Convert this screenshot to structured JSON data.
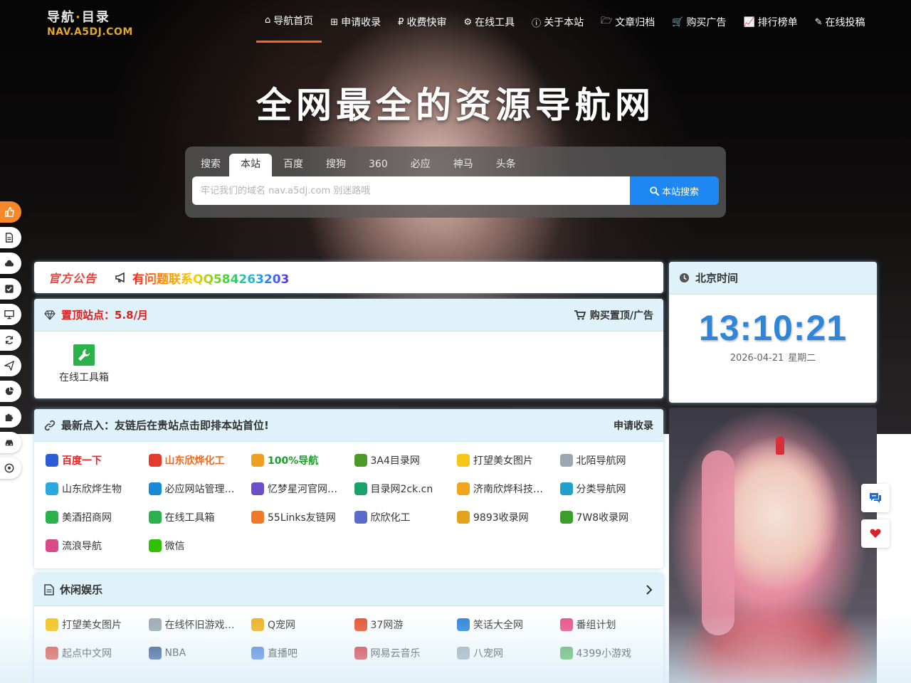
{
  "logo": {
    "line1_a": "导航",
    "line1_sep": "·",
    "line1_b": "目录",
    "line2": "NAV.A5DJ.COM"
  },
  "nav": [
    {
      "label": "导航首页",
      "icon": "home-icon"
    },
    {
      "label": "申请收录",
      "icon": "plus-square-icon"
    },
    {
      "label": "收费快审",
      "icon": "ruble-icon"
    },
    {
      "label": "在线工具",
      "icon": "gears-icon"
    },
    {
      "label": "关于本站",
      "icon": "info-icon"
    },
    {
      "label": "文章归档",
      "icon": "folder-open-icon"
    },
    {
      "label": "购买广告",
      "icon": "cart-icon"
    },
    {
      "label": "排行榜单",
      "icon": "line-chart-icon"
    },
    {
      "label": "在线投稿",
      "icon": "edit-icon"
    }
  ],
  "hero": {
    "title": "全网最全的资源导航网"
  },
  "search": {
    "lead": "搜索",
    "tabs": [
      "本站",
      "百度",
      "搜狗",
      "360",
      "必应",
      "神马",
      "头条"
    ],
    "active_tab": "本站",
    "placeholder": "牢记我们的域名 nav.a5dj.com 别迷路哦",
    "value": "",
    "button_label": "本站搜索"
  },
  "left_tools": [
    {
      "icon": "thumbs-up-icon"
    },
    {
      "icon": "file-icon"
    },
    {
      "icon": "cloud-icon"
    },
    {
      "icon": "check-square-icon"
    },
    {
      "icon": "desktop-icon"
    },
    {
      "icon": "refresh-icon"
    },
    {
      "icon": "paper-plane-icon"
    },
    {
      "icon": "pie-chart-icon"
    },
    {
      "icon": "puzzle-icon"
    },
    {
      "icon": "car-icon"
    },
    {
      "icon": "soccer-ball-icon"
    }
  ],
  "notice": {
    "label": "官方公告",
    "text": "有问题联系QQ584263203"
  },
  "clock": {
    "title": "北京时间",
    "time": "13:10:21",
    "date": "2026-04-21",
    "weekday": "星期二"
  },
  "pinned": {
    "title": "置顶站点：5.8/月",
    "right_label": "购买置顶/广告",
    "items": [
      {
        "label": "在线工具箱"
      }
    ]
  },
  "latest": {
    "title": "最新点入：友链后在贵站点击即排本站首位!",
    "right_label": "申请收录",
    "items": [
      {
        "label": "百度一下",
        "style": "red",
        "color": "#2c5cd8"
      },
      {
        "label": "山东欣烨化工",
        "style": "orange",
        "color": "#e23c2c"
      },
      {
        "label": "100%导航",
        "style": "green",
        "color": "#f0a020"
      },
      {
        "label": "3A4目录网",
        "style": "",
        "color": "#4c9a2a"
      },
      {
        "label": "打望美女图片",
        "style": "",
        "color": "#f5c518"
      },
      {
        "label": "北陌导航网",
        "style": "",
        "color": "#9aa7b2"
      },
      {
        "label": "山东欣烨生物",
        "style": "",
        "color": "#2aa8e0"
      },
      {
        "label": "必应网站管理…",
        "style": "",
        "color": "#1b8ad6"
      },
      {
        "label": "忆梦星河官网…",
        "style": "",
        "color": "#6b4fc8"
      },
      {
        "label": "目录网2ck.cn",
        "style": "",
        "color": "#1aa26a"
      },
      {
        "label": "济南欣烨科技…",
        "style": "",
        "color": "#f0a51c"
      },
      {
        "label": "分类导航网",
        "style": "",
        "color": "#1fa1c9"
      },
      {
        "label": "美酒招商网",
        "style": "",
        "color": "#2bb24c"
      },
      {
        "label": "在线工具箱",
        "style": "",
        "color": "#2bb24c"
      },
      {
        "label": "55Links友链网",
        "style": "",
        "color": "#f07a2a"
      },
      {
        "label": "欣欣化工",
        "style": "",
        "color": "#5c6bc8"
      },
      {
        "label": "9893收录网",
        "style": "",
        "color": "#e3a21a"
      },
      {
        "label": "7W8收录网",
        "style": "",
        "color": "#3a9f2a"
      },
      {
        "label": "流浪导航",
        "style": "",
        "color": "#d84a8a"
      },
      {
        "label": "微信",
        "style": "",
        "color": "#2dc100"
      }
    ]
  },
  "leisure": {
    "title": "休闲娱乐",
    "items": [
      {
        "label": "打望美女图片",
        "color": "#f5c518"
      },
      {
        "label": "在线怀旧游戏…",
        "color": "#9aa7b2"
      },
      {
        "label": "Q宠网",
        "color": "#f0b21a"
      },
      {
        "label": "37网游",
        "color": "#e8522a"
      },
      {
        "label": "笑话大全网",
        "color": "#2a84d8"
      },
      {
        "label": "番组计划",
        "color": "#e8508a"
      },
      {
        "label": "起点中文网",
        "color": "#e23c2c"
      },
      {
        "label": "NBA",
        "color": "#1d428a"
      },
      {
        "label": "直播吧",
        "color": "#3a7ad8"
      },
      {
        "label": "网易云音乐",
        "color": "#d8232a"
      },
      {
        "label": "八宠网",
        "color": "#9aa7b2"
      },
      {
        "label": "4399小游戏",
        "color": "#4caf50"
      }
    ]
  },
  "float_buttons": [
    {
      "icon": "chat-icon",
      "color": "#1e6ce0"
    },
    {
      "icon": "heart-icon",
      "color": "#d8232a"
    }
  ]
}
